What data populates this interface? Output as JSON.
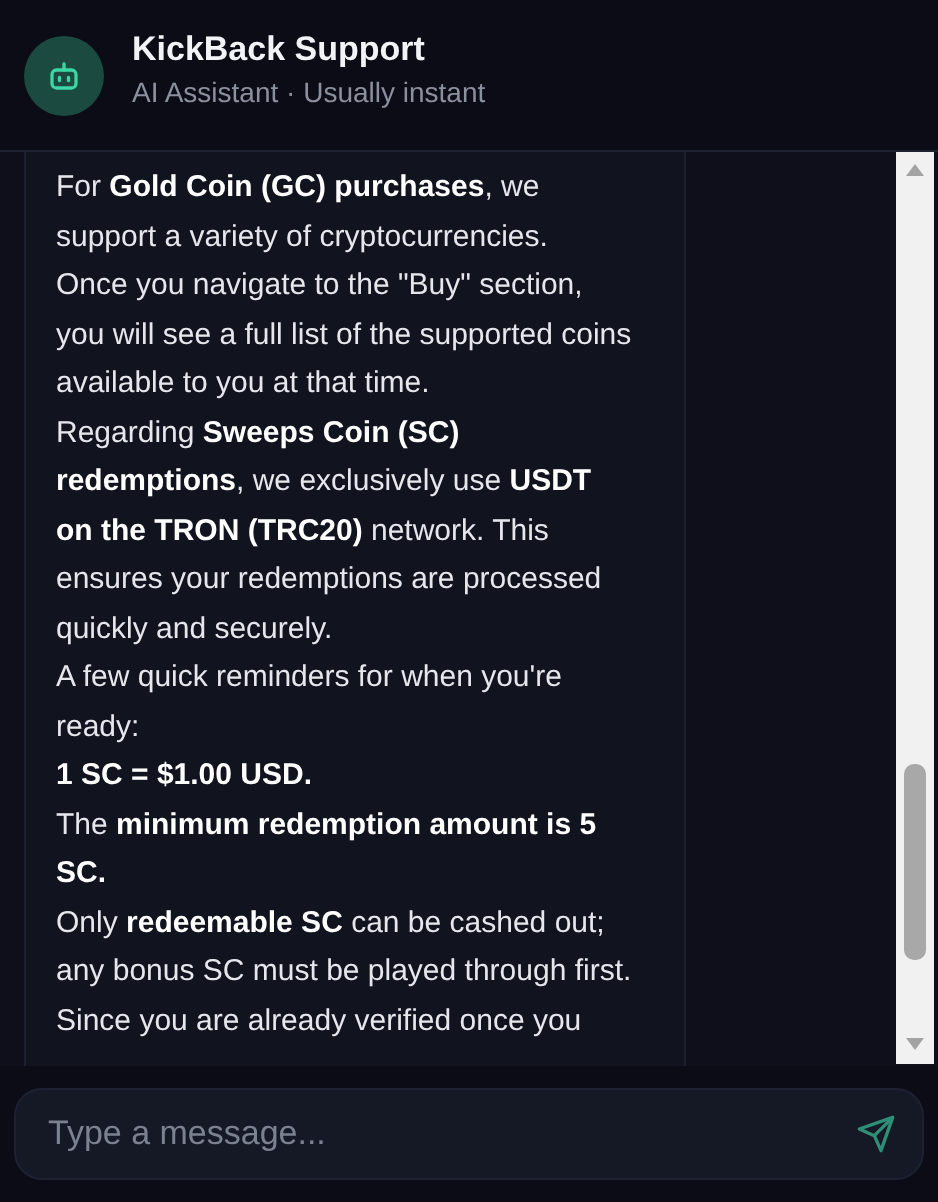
{
  "header": {
    "title": "KickBack Support",
    "subtitle": "AI Assistant · Usually instant"
  },
  "message": {
    "paragraphs": [
      "For **Gold Coin (GC) purchases**, we support a variety of cryptocurrencies.",
      "Once you navigate to the \"Buy\" section, you will see a full list of the supported coins available to you at that time.",
      "Regarding **Sweeps Coin (SC) redemptions**, we exclusively use **USDT on the TRON (TRC20)** network. This ensures your redemptions are processed quickly and securely.",
      "A few quick reminders for when you're ready:",
      "**1 SC = $1.00 USD.**",
      "The **minimum redemption amount is 5 SC.**",
      "Only **redeemable SC** can be cashed out; any bonus SC must be played through first.",
      "Since you are already verified once you"
    ]
  },
  "composer": {
    "placeholder": "Type a message..."
  }
}
